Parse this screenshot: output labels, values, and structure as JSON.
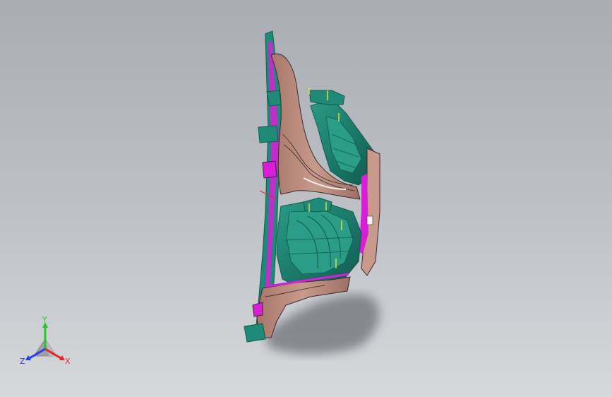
{
  "viewport": {
    "background_top": "#a9adb3",
    "background_bottom": "#d6d8db"
  },
  "model": {
    "colors": {
      "body_surface": "#c89a8c",
      "body_shadow": "#9e6f63",
      "rib_green": "#1f8a78",
      "rib_dark": "#0f5a4e",
      "edge_magenta": "#d81ed8",
      "edge_dark": "#3a2a2a",
      "datum_yellow": "#e6e63a",
      "ground_shadow": "#6e7177"
    }
  },
  "triad": {
    "x_label": "X",
    "y_label": "Y",
    "z_label": "Z",
    "x_color": "#e8242a",
    "y_color": "#2cc52c",
    "z_color": "#2a3ee6"
  }
}
